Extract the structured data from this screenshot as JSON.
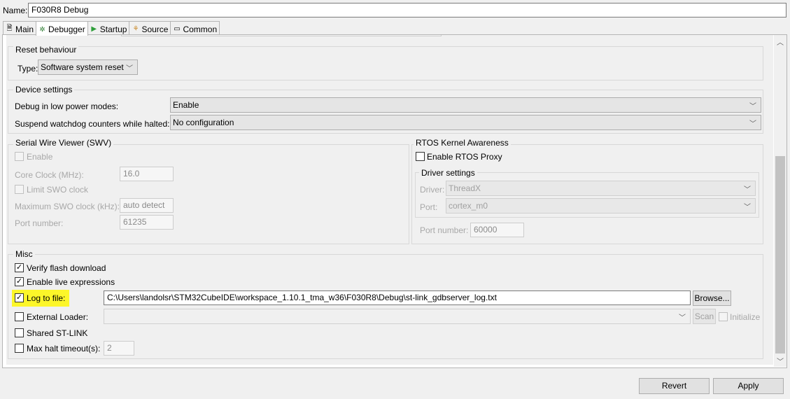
{
  "name": {
    "label": "Name:",
    "value": "F030R8 Debug"
  },
  "tabs": [
    {
      "label": "Main",
      "icon": "page-icon"
    },
    {
      "label": "Debugger",
      "icon": "debugger-icon"
    },
    {
      "label": "Startup",
      "icon": "play-icon"
    },
    {
      "label": "Source",
      "icon": "source-icon"
    },
    {
      "label": "Common",
      "icon": "common-icon"
    }
  ],
  "reset": {
    "title": "Reset behaviour",
    "type_label": "Type:",
    "type_value": "Software system reset"
  },
  "device": {
    "title": "Device settings",
    "low_power_label": "Debug in low power modes:",
    "low_power_value": "Enable",
    "watchdog_label": "Suspend watchdog counters while halted:",
    "watchdog_value": "No configuration"
  },
  "swv": {
    "title": "Serial Wire Viewer (SWV)",
    "enable_label": "Enable",
    "core_clock_label": "Core Clock (MHz):",
    "core_clock_value": "16.0",
    "limit_label": "Limit SWO clock",
    "max_clock_label": "Maximum SWO clock (kHz):",
    "max_clock_value": "auto detect",
    "port_label": "Port number:",
    "port_value": "61235"
  },
  "rtos": {
    "title": "RTOS Kernel Awareness",
    "proxy_label": "Enable RTOS Proxy",
    "driver_title": "Driver settings",
    "driver_label": "Driver:",
    "driver_value": "ThreadX",
    "port_label": "Port:",
    "port_value": "cortex_m0",
    "port_number_label": "Port number:",
    "port_number_value": "60000"
  },
  "misc": {
    "title": "Misc",
    "verify_label": "Verify flash download",
    "live_label": "Enable live expressions",
    "log_label": "Log to file:",
    "log_path": "C:\\Users\\landolsr\\STM32CubeIDE\\workspace_1.10.1_tma_w36\\F030R8\\Debug\\st-link_gdbserver_log.txt",
    "browse_label": "Browse...",
    "loader_label": "External Loader:",
    "scan_label": "Scan",
    "init_label": "Initialize",
    "shared_label": "Shared ST-LINK",
    "halt_label": "Max halt timeout(s):",
    "halt_value": "2"
  },
  "footer": {
    "revert_label": "Revert",
    "apply_label": "Apply"
  },
  "colors": {
    "highlight": "#fcf629",
    "accent_green": "#2e9e3a"
  }
}
